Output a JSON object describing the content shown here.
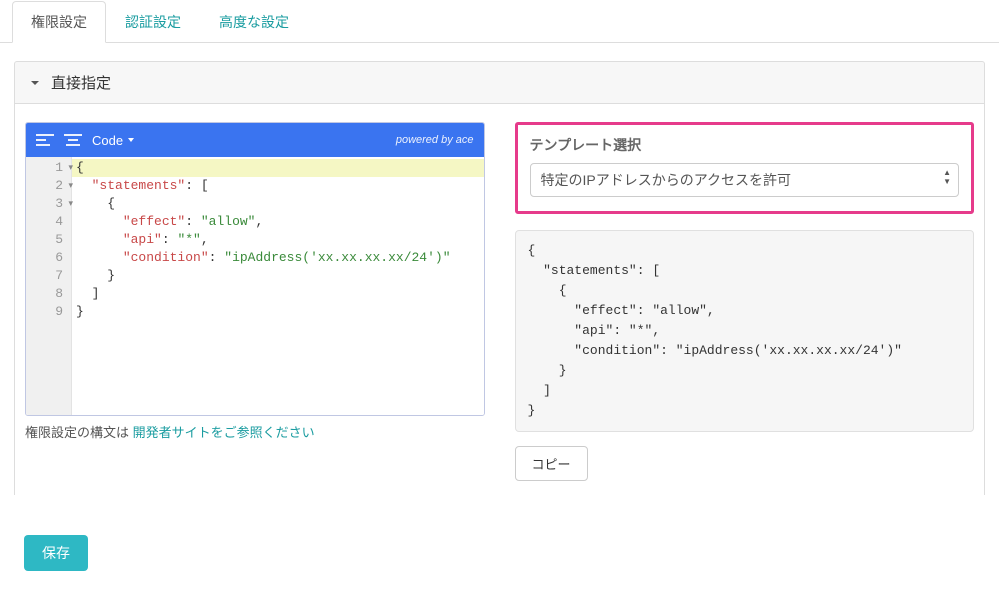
{
  "tabs": {
    "permission": "権限設定",
    "auth": "認証設定",
    "advanced": "高度な設定",
    "active": "permission"
  },
  "panel": {
    "title": "直接指定"
  },
  "editor": {
    "code_label": "Code",
    "powered": "powered by ace",
    "lines": [
      "{",
      "  \"statements\": [",
      "    {",
      "      \"effect\": \"allow\",",
      "      \"api\": \"*\",",
      "      \"condition\": \"ipAddress('xx.xx.xx.xx/24')\"",
      "    }",
      "  ]",
      "}"
    ],
    "fold_lines": [
      1,
      2,
      3
    ]
  },
  "helper": {
    "prefix": "権限設定の構文は ",
    "link": "開発者サイトをご参照ください"
  },
  "template": {
    "title": "テンプレート選択",
    "selected": "特定のIPアドレスからのアクセスを許可",
    "preview": "{\n  \"statements\": [\n    {\n      \"effect\": \"allow\",\n      \"api\": \"*\",\n      \"condition\": \"ipAddress('xx.xx.xx.xx/24')\"\n    }\n  ]\n}"
  },
  "buttons": {
    "copy": "コピー",
    "save": "保存"
  }
}
